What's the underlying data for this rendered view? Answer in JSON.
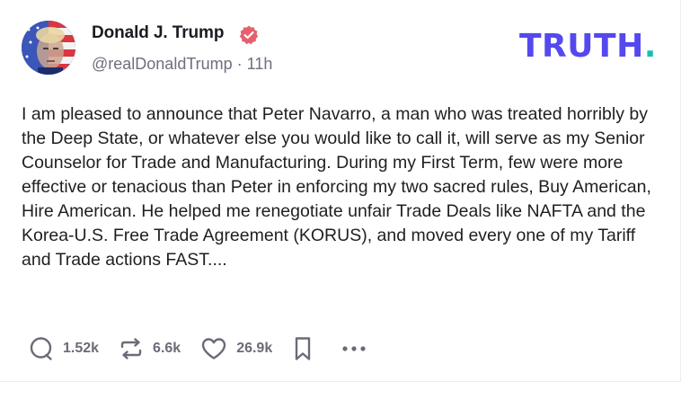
{
  "post": {
    "author": {
      "display_name": "Donald J. Trump",
      "handle": "@realDonaldTrump",
      "separator": "·",
      "time_ago": "11h",
      "verified": true
    },
    "brand": {
      "logo_text": "TRUTH",
      "logo_dot": ".",
      "color_primary": "#5448ee",
      "color_accent": "#14c1b1"
    },
    "body": "I am pleased to announce that Peter Navarro, a man who was treated horribly by the Deep State, or whatever else you would like to call it, will serve as my Senior Counselor for Trade and Manufacturing. During my First Term, few were more effective or tenacious than Peter in enforcing my two sacred rules, Buy American, Hire American. He helped me renegotiate unfair Trade Deals like NAFTA and the Korea-U.S. Free Trade Agreement (KORUS), and moved every one of my Tariff and Trade actions FAST....",
    "actions": {
      "replies": {
        "icon": "reply-icon",
        "count": "1.52k"
      },
      "retruths": {
        "icon": "retruth-icon",
        "count": "6.6k"
      },
      "likes": {
        "icon": "heart-icon",
        "count": "26.9k"
      },
      "bookmark": {
        "icon": "bookmark-icon"
      },
      "more": {
        "icon": "more-options-icon"
      }
    },
    "badge_color": "#e5606e"
  }
}
